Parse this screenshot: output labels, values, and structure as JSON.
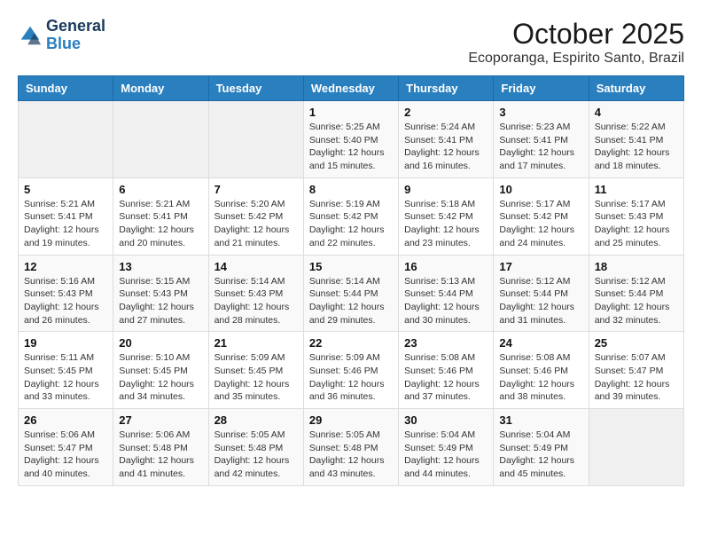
{
  "header": {
    "logo_line1": "General",
    "logo_line2": "Blue",
    "title": "October 2025",
    "subtitle": "Ecoporanga, Espirito Santo, Brazil"
  },
  "weekdays": [
    "Sunday",
    "Monday",
    "Tuesday",
    "Wednesday",
    "Thursday",
    "Friday",
    "Saturday"
  ],
  "weeks": [
    [
      {
        "day": "",
        "info": ""
      },
      {
        "day": "",
        "info": ""
      },
      {
        "day": "",
        "info": ""
      },
      {
        "day": "1",
        "info": "Sunrise: 5:25 AM\nSunset: 5:40 PM\nDaylight: 12 hours\nand 15 minutes."
      },
      {
        "day": "2",
        "info": "Sunrise: 5:24 AM\nSunset: 5:41 PM\nDaylight: 12 hours\nand 16 minutes."
      },
      {
        "day": "3",
        "info": "Sunrise: 5:23 AM\nSunset: 5:41 PM\nDaylight: 12 hours\nand 17 minutes."
      },
      {
        "day": "4",
        "info": "Sunrise: 5:22 AM\nSunset: 5:41 PM\nDaylight: 12 hours\nand 18 minutes."
      }
    ],
    [
      {
        "day": "5",
        "info": "Sunrise: 5:21 AM\nSunset: 5:41 PM\nDaylight: 12 hours\nand 19 minutes."
      },
      {
        "day": "6",
        "info": "Sunrise: 5:21 AM\nSunset: 5:41 PM\nDaylight: 12 hours\nand 20 minutes."
      },
      {
        "day": "7",
        "info": "Sunrise: 5:20 AM\nSunset: 5:42 PM\nDaylight: 12 hours\nand 21 minutes."
      },
      {
        "day": "8",
        "info": "Sunrise: 5:19 AM\nSunset: 5:42 PM\nDaylight: 12 hours\nand 22 minutes."
      },
      {
        "day": "9",
        "info": "Sunrise: 5:18 AM\nSunset: 5:42 PM\nDaylight: 12 hours\nand 23 minutes."
      },
      {
        "day": "10",
        "info": "Sunrise: 5:17 AM\nSunset: 5:42 PM\nDaylight: 12 hours\nand 24 minutes."
      },
      {
        "day": "11",
        "info": "Sunrise: 5:17 AM\nSunset: 5:43 PM\nDaylight: 12 hours\nand 25 minutes."
      }
    ],
    [
      {
        "day": "12",
        "info": "Sunrise: 5:16 AM\nSunset: 5:43 PM\nDaylight: 12 hours\nand 26 minutes."
      },
      {
        "day": "13",
        "info": "Sunrise: 5:15 AM\nSunset: 5:43 PM\nDaylight: 12 hours\nand 27 minutes."
      },
      {
        "day": "14",
        "info": "Sunrise: 5:14 AM\nSunset: 5:43 PM\nDaylight: 12 hours\nand 28 minutes."
      },
      {
        "day": "15",
        "info": "Sunrise: 5:14 AM\nSunset: 5:44 PM\nDaylight: 12 hours\nand 29 minutes."
      },
      {
        "day": "16",
        "info": "Sunrise: 5:13 AM\nSunset: 5:44 PM\nDaylight: 12 hours\nand 30 minutes."
      },
      {
        "day": "17",
        "info": "Sunrise: 5:12 AM\nSunset: 5:44 PM\nDaylight: 12 hours\nand 31 minutes."
      },
      {
        "day": "18",
        "info": "Sunrise: 5:12 AM\nSunset: 5:44 PM\nDaylight: 12 hours\nand 32 minutes."
      }
    ],
    [
      {
        "day": "19",
        "info": "Sunrise: 5:11 AM\nSunset: 5:45 PM\nDaylight: 12 hours\nand 33 minutes."
      },
      {
        "day": "20",
        "info": "Sunrise: 5:10 AM\nSunset: 5:45 PM\nDaylight: 12 hours\nand 34 minutes."
      },
      {
        "day": "21",
        "info": "Sunrise: 5:09 AM\nSunset: 5:45 PM\nDaylight: 12 hours\nand 35 minutes."
      },
      {
        "day": "22",
        "info": "Sunrise: 5:09 AM\nSunset: 5:46 PM\nDaylight: 12 hours\nand 36 minutes."
      },
      {
        "day": "23",
        "info": "Sunrise: 5:08 AM\nSunset: 5:46 PM\nDaylight: 12 hours\nand 37 minutes."
      },
      {
        "day": "24",
        "info": "Sunrise: 5:08 AM\nSunset: 5:46 PM\nDaylight: 12 hours\nand 38 minutes."
      },
      {
        "day": "25",
        "info": "Sunrise: 5:07 AM\nSunset: 5:47 PM\nDaylight: 12 hours\nand 39 minutes."
      }
    ],
    [
      {
        "day": "26",
        "info": "Sunrise: 5:06 AM\nSunset: 5:47 PM\nDaylight: 12 hours\nand 40 minutes."
      },
      {
        "day": "27",
        "info": "Sunrise: 5:06 AM\nSunset: 5:48 PM\nDaylight: 12 hours\nand 41 minutes."
      },
      {
        "day": "28",
        "info": "Sunrise: 5:05 AM\nSunset: 5:48 PM\nDaylight: 12 hours\nand 42 minutes."
      },
      {
        "day": "29",
        "info": "Sunrise: 5:05 AM\nSunset: 5:48 PM\nDaylight: 12 hours\nand 43 minutes."
      },
      {
        "day": "30",
        "info": "Sunrise: 5:04 AM\nSunset: 5:49 PM\nDaylight: 12 hours\nand 44 minutes."
      },
      {
        "day": "31",
        "info": "Sunrise: 5:04 AM\nSunset: 5:49 PM\nDaylight: 12 hours\nand 45 minutes."
      },
      {
        "day": "",
        "info": ""
      }
    ]
  ]
}
